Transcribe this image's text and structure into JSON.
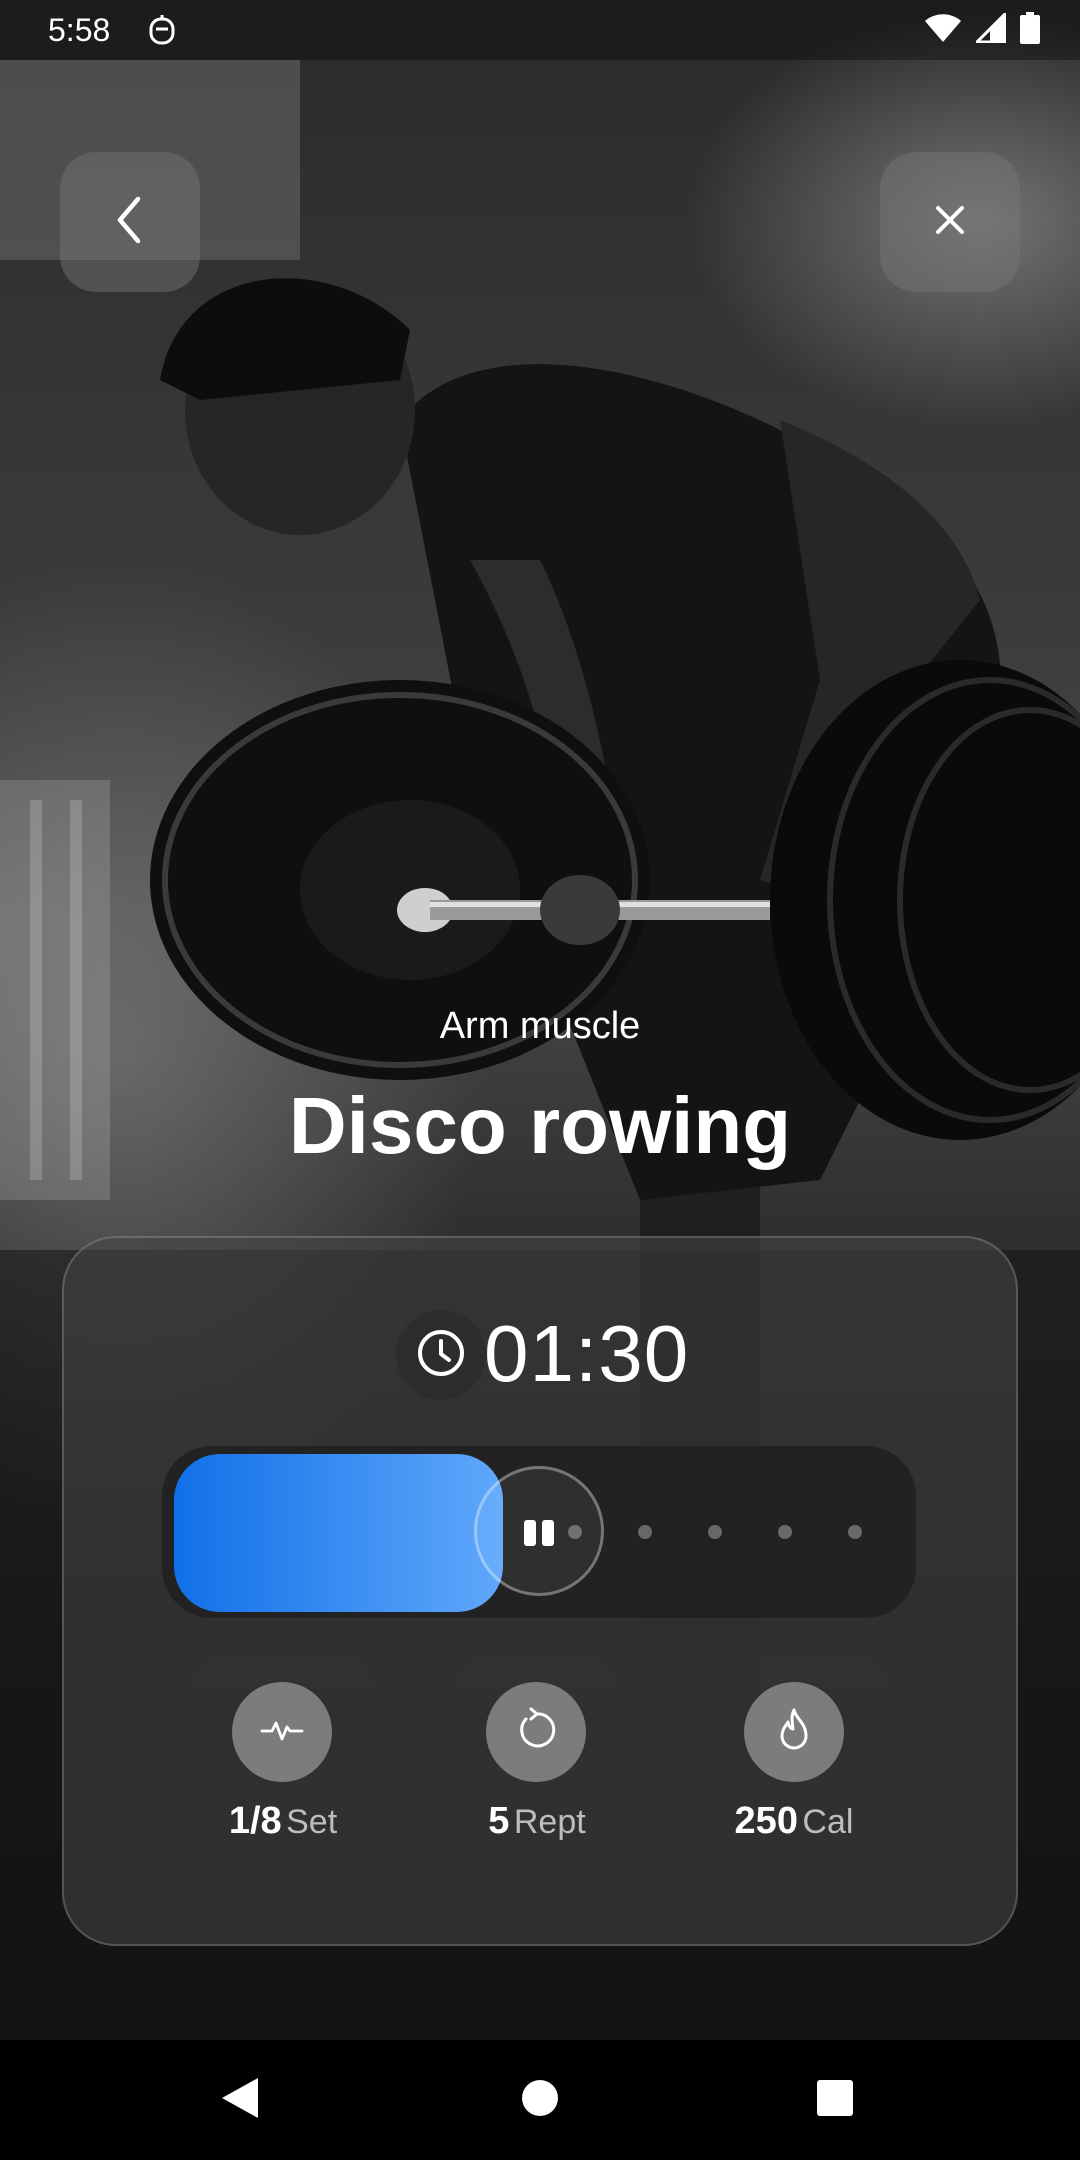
{
  "status_bar": {
    "time": "5:58"
  },
  "header": {
    "back_icon": "chevron-left-icon",
    "close_icon": "close-icon"
  },
  "workout": {
    "category": "Arm muscle",
    "title": "Disco rowing"
  },
  "timer": {
    "icon": "clock-icon",
    "value": "01:30"
  },
  "progress": {
    "fraction": 0.45,
    "steps_remaining": 5,
    "fill_color_start": "#1170e8",
    "fill_color_end": "#60a8fb"
  },
  "stats": [
    {
      "icon": "activity-pulse-icon",
      "value": "1/8",
      "unit": "Set"
    },
    {
      "icon": "repeat-icon",
      "value": "5",
      "unit": "Rept"
    },
    {
      "icon": "flame-icon",
      "value": "250",
      "unit": "Cal"
    }
  ]
}
